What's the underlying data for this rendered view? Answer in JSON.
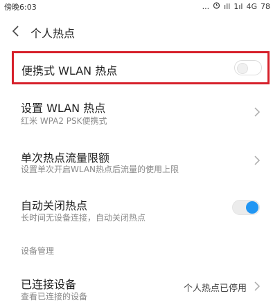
{
  "status_bar": {
    "time": "傍晚6:03",
    "dots": "...",
    "alarm_icon": "alarm-icon",
    "signal_1": "ıll",
    "signal_2": "1ıl",
    "network": "4G",
    "battery": "78"
  },
  "header": {
    "title": "个人热点",
    "back_icon": "chevron-left-icon"
  },
  "portable_hotspot": {
    "label": "便携式 WLAN 热点",
    "enabled": false
  },
  "settings": {
    "wlan": {
      "title": "设置 WLAN 热点",
      "subtitle": "红米 WPA2 PSK便携式"
    },
    "traffic_limit": {
      "title": "单次热点流量限额",
      "subtitle": "设置单次开启WLAN热点后流量的使用上限"
    },
    "auto_close": {
      "title": "自动关闭热点",
      "subtitle": "长时间无设备连接，自动关闭热点",
      "enabled": true
    }
  },
  "device_section": {
    "header": "设备管理",
    "connected": {
      "title": "已连接设备",
      "subtitle": "查看已连接的设备",
      "value": "个人热点已停用"
    }
  }
}
